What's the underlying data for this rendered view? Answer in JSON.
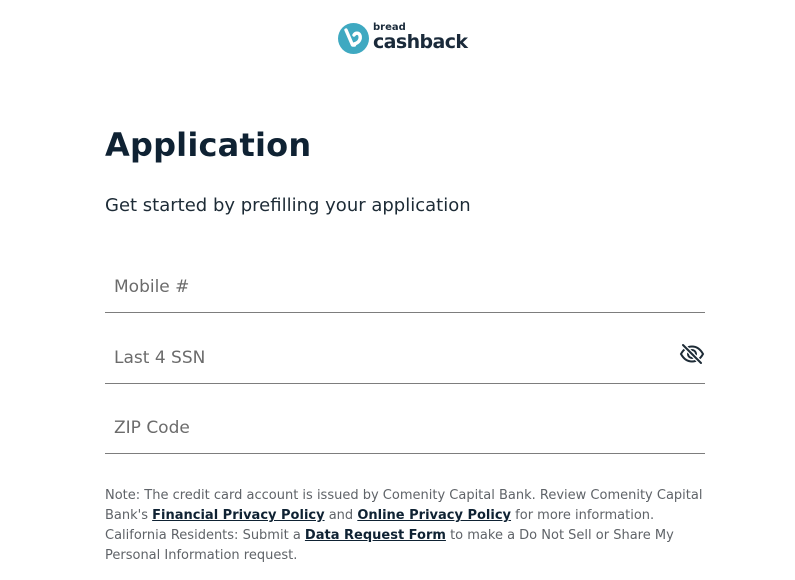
{
  "logo": {
    "small_text": "bread",
    "big_text": "cashback",
    "brand_color": "#3fa9c1",
    "icon": "bread-logo-icon"
  },
  "page": {
    "title": "Application",
    "subtitle": "Get started by prefilling your application"
  },
  "form": {
    "mobile": {
      "placeholder": "Mobile #",
      "value": ""
    },
    "ssn": {
      "placeholder": "Last 4 SSN",
      "value": "",
      "toggle_icon": "eye-slash-icon"
    },
    "zip": {
      "placeholder": "ZIP Code",
      "value": ""
    }
  },
  "note": {
    "part1": "Note: The credit card account is issued by Comenity Capital Bank. Review Comenity Capital Bank's ",
    "link_financial": "Financial Privacy Policy",
    "part2": " and ",
    "link_online": "Online Privacy Policy",
    "part3": " for more information. California Residents: Submit a ",
    "link_request": "Data Request Form",
    "part4": " to make a Do Not Sell or Share My Personal Information request."
  }
}
